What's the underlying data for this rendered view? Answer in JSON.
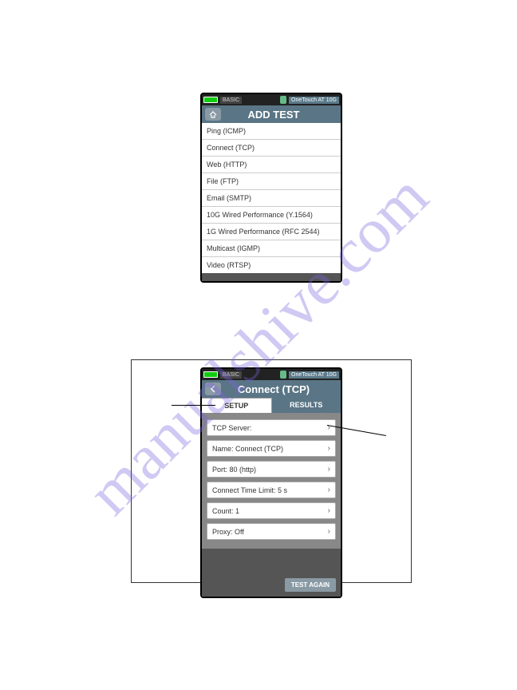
{
  "status": {
    "basic_label": "BASIC",
    "device_label": "OneTouch AT 10G"
  },
  "screen1": {
    "title": "ADD TEST",
    "items": [
      "Ping (ICMP)",
      "Connect (TCP)",
      "Web (HTTP)",
      "File (FTP)",
      "Email (SMTP)",
      "10G Wired Performance (Y.1564)",
      "1G Wired Performance (RFC 2544)",
      "Multicast (IGMP)",
      "Video (RTSP)"
    ]
  },
  "screen2": {
    "title": "Connect (TCP)",
    "tabs": {
      "setup": "SETUP",
      "results": "RESULTS"
    },
    "rows": [
      "TCP Server:",
      "Name: Connect (TCP)",
      "Port: 80 (http)",
      "Connect Time Limit: 5 s",
      "Count: 1",
      "Proxy: Off"
    ],
    "action": "TEST AGAIN"
  },
  "watermark": "manualshive.com"
}
